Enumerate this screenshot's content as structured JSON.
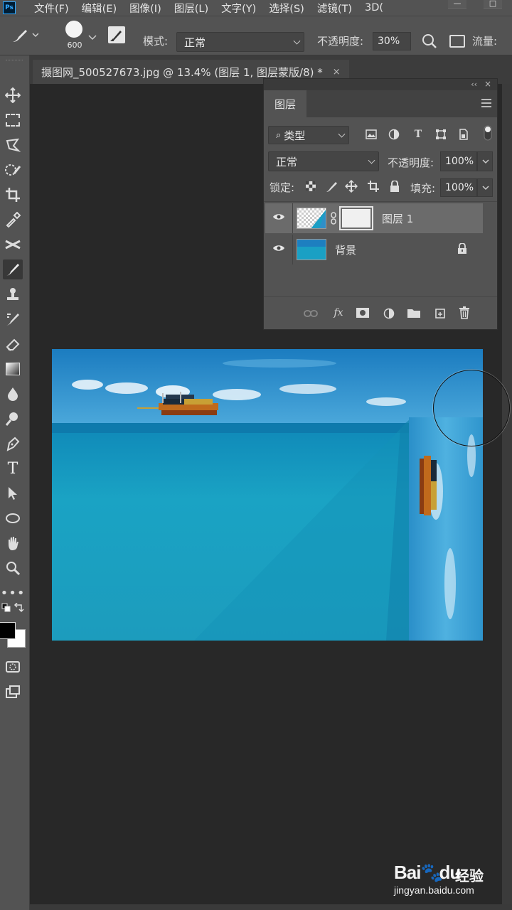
{
  "app": {
    "logo_text": "Ps"
  },
  "menu": [
    "文件(F)",
    "编辑(E)",
    "图像(I)",
    "图层(L)",
    "文字(Y)",
    "选择(S)",
    "滤镜(T)",
    "3D("
  ],
  "options_bar": {
    "brush_size": "600",
    "mode_label": "模式:",
    "mode_value": "正常",
    "opacity_label": "不透明度:",
    "opacity_value": "30%",
    "flow_label": "流量:"
  },
  "document": {
    "tab_title": "摄图网_500527673.jpg @ 13.4% (图层 1, 图层蒙版/8) *",
    "tab_close": "×"
  },
  "layers_panel": {
    "tab_label": "图层",
    "collapse_glyph": "‹‹",
    "close_glyph": "×",
    "filter_label": "类型",
    "blend_mode": "正常",
    "opacity_label": "不透明度:",
    "opacity_value": "100%",
    "lock_label": "锁定:",
    "fill_label": "填充:",
    "fill_value": "100%",
    "layers": [
      {
        "name": "图层 1",
        "selected": true,
        "has_mask": true,
        "locked": false
      },
      {
        "name": "背景",
        "selected": false,
        "has_mask": false,
        "locked": true
      }
    ]
  },
  "colors": {
    "ui_panel": "#535353",
    "canvas_bg": "#282828",
    "selected_layer": "#6b6b6b",
    "accent": "#31a8ff"
  },
  "watermark": {
    "brand": "Bai",
    "brand_suffix": "du",
    "jingyan": "经验",
    "url": "jingyan.baidu.com"
  }
}
